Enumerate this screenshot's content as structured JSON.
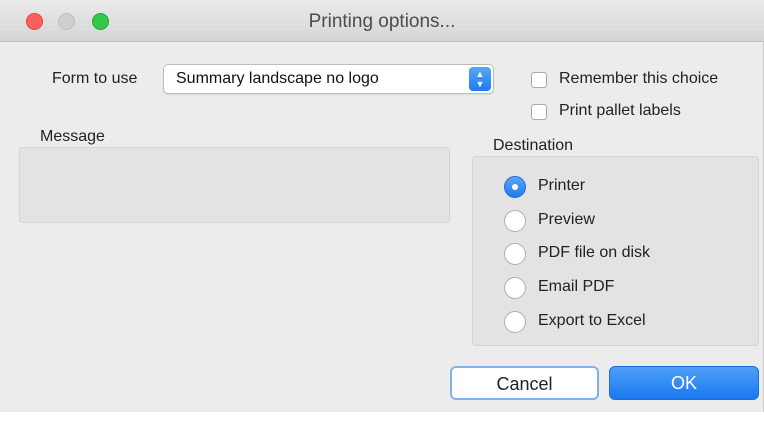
{
  "window": {
    "title": "Printing options..."
  },
  "form": {
    "label": "Form to use",
    "selected": "Summary landscape no logo"
  },
  "options": [
    {
      "label": "Remember this choice",
      "checked": false
    },
    {
      "label": "Print pallet labels",
      "checked": false
    }
  ],
  "message": {
    "label": "Message",
    "value": ""
  },
  "destination": {
    "label": "Destination",
    "selected": "Printer",
    "choices": [
      "Printer",
      "Preview",
      "PDF file on disk",
      "Email PDF",
      "Export to Excel"
    ]
  },
  "buttons": {
    "cancel": "Cancel",
    "ok": "OK"
  },
  "colors": {
    "accent": "#1f7bf0",
    "close": "#fc605c",
    "maximize": "#34c84a"
  },
  "icons": {
    "select_arrows": "up-down-chevron-icon"
  }
}
